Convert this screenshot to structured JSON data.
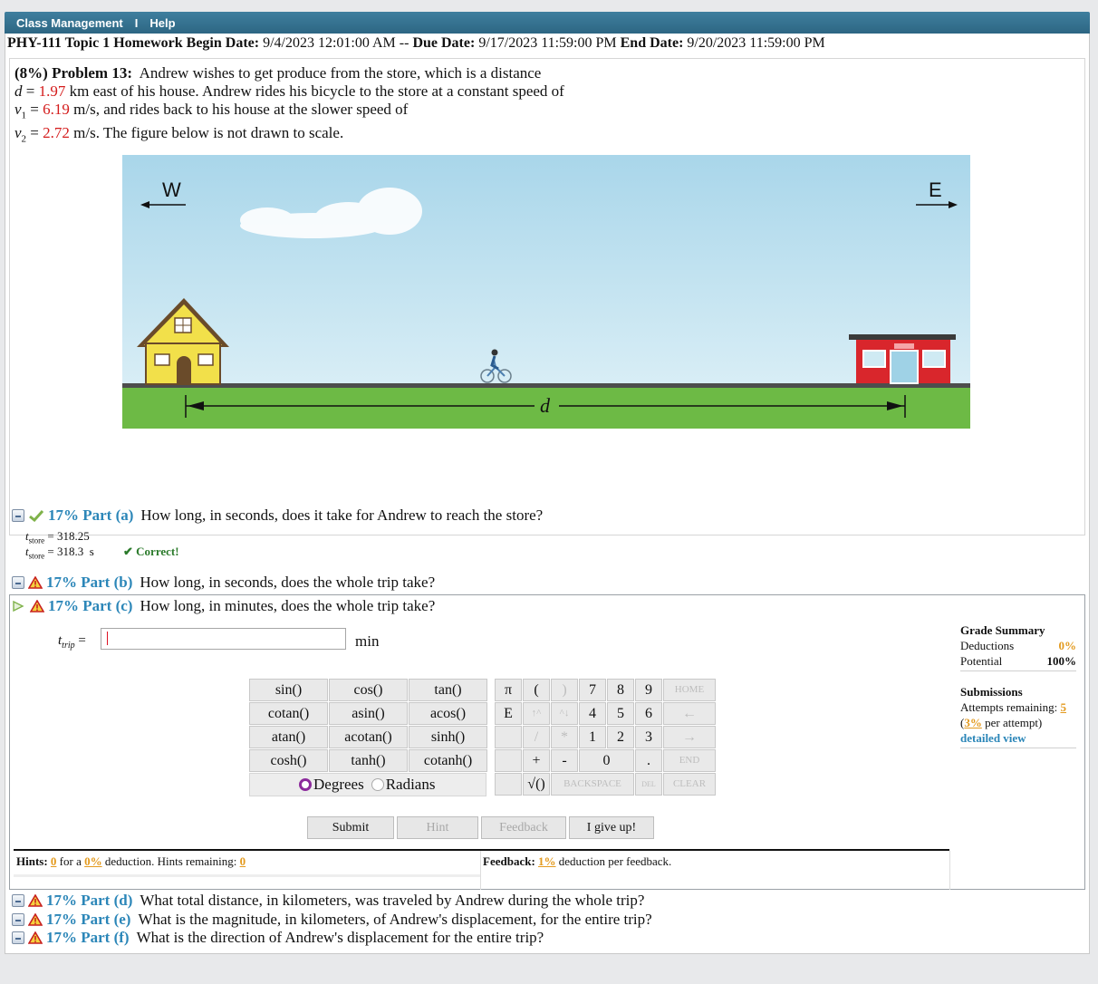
{
  "nav": {
    "class_management": "Class Management",
    "separator": "I",
    "help": "Help"
  },
  "header": {
    "course_topic": "PHY-111 Topic 1 Homework",
    "begin_label": "Begin Date:",
    "begin_value": "9/4/2023 12:01:00 AM --",
    "due_label": "Due Date:",
    "due_value": "9/17/2023 11:59:00 PM",
    "end_label": "End Date:",
    "end_value": "9/20/2023 11:59:00 PM"
  },
  "problem": {
    "weight": "(8%)",
    "title": "Problem 13:",
    "line1": "Andrew wishes to get produce from the store, which is a distance",
    "d_symbol": "d",
    "d_value": "1.97",
    "line2_rest": "km east of his house. Andrew rides his bicycle to the store at a constant speed of",
    "v1_symbol": "v",
    "v1_value": "6.19",
    "line3_rest": "m/s, and rides back to his house at the slower speed of",
    "v2_symbol": "v",
    "v2_value": "2.72",
    "line4_rest": "m/s. The figure below is not drawn to scale.",
    "figure": {
      "west": "W",
      "east": "E",
      "distance_label": "d"
    }
  },
  "parts": {
    "a": {
      "label": "17% Part (a)",
      "question": "How long, in seconds, does it take for Andrew to reach the store?",
      "entered_var": "t",
      "entered_sub": "store",
      "entered": "= 318.25",
      "answer_var": "t",
      "answer_sub": "store",
      "answer": "= 318.3  s",
      "status": "Correct!"
    },
    "b": {
      "label": "17% Part (b)",
      "question": "How long, in seconds, does the whole trip take?"
    },
    "c": {
      "label": "17% Part (c)",
      "question": "How long, in minutes, does the whole trip take?",
      "var": "t",
      "sub": "trip",
      "eq": "=",
      "input_value": "",
      "units": "min"
    },
    "d": {
      "label": "17% Part (d)",
      "question": "What total distance, in kilometers, was traveled by Andrew during the whole trip?"
    },
    "e": {
      "label": "17% Part (e)",
      "question": "What is the magnitude, in kilometers, of Andrew's displacement, for the entire trip?"
    },
    "f": {
      "label": "17% Part (f)",
      "question": "What is the direction of Andrew's displacement for the entire trip?"
    }
  },
  "grade_summary": {
    "title": "Grade Summary",
    "deductions_label": "Deductions",
    "deductions_value": "0%",
    "potential_label": "Potential",
    "potential_value": "100%",
    "submissions_title": "Submissions",
    "attempts_label": "Attempts remaining:",
    "attempts_value": "5",
    "per_attempt_open": "(",
    "per_attempt_value": "3%",
    "per_attempt_rest": "per attempt)",
    "detailed_view": "detailed view"
  },
  "calculator": {
    "functions": [
      [
        "sin()",
        "cos()",
        "tan()"
      ],
      [
        "cotan()",
        "asin()",
        "acos()"
      ],
      [
        "atan()",
        "acotan()",
        "sinh()"
      ],
      [
        "cosh()",
        "tanh()",
        "cotanh()"
      ]
    ],
    "degrees": "Degrees",
    "radians": "Radians",
    "keys": {
      "pi": "π",
      "lparen": "(",
      "rparen": ")",
      "seven": "7",
      "eight": "8",
      "nine": "9",
      "home": "HOME",
      "e": "E",
      "up": "↑^",
      "down": "^↓",
      "four": "4",
      "five": "5",
      "six": "6",
      "left": "←",
      "divide": "/",
      "times": "*",
      "one": "1",
      "two": "2",
      "three": "3",
      "right": "→",
      "plus": "+",
      "minus": "-",
      "zero": "0",
      "dot": ".",
      "end": "END",
      "sqrt": "√()",
      "backspace": "BACKSPACE",
      "del": "DEL",
      "clear": "CLEAR"
    }
  },
  "actions": {
    "submit": "Submit",
    "hint": "Hint",
    "feedback": "Feedback",
    "give_up": "I give up!"
  },
  "hints": {
    "label": "Hints:",
    "count": "0",
    "for_a": "for a",
    "pct": "0%",
    "deduction": "deduction. Hints remaining:",
    "remaining": "0"
  },
  "feedback": {
    "label": "Feedback:",
    "pct": "1%",
    "text": "deduction per feedback."
  },
  "colors": {
    "topbar": "#2d6683",
    "part_label": "#2b86b8",
    "given_value": "#d41c1c",
    "accent_orange": "#e39a1e"
  }
}
